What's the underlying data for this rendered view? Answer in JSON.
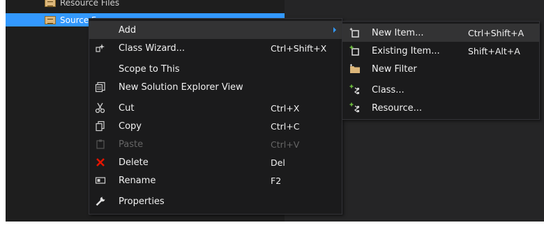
{
  "tree": {
    "partial_item": "Resource Files",
    "selected_item": "Source F"
  },
  "context_menu": {
    "items": [
      {
        "label": "Add",
        "shortcut": "",
        "icon": "none"
      },
      {
        "label": "Class Wizard...",
        "shortcut": "Ctrl+Shift+X",
        "icon": "class-wizard-icon"
      },
      {
        "label": "Scope to This",
        "shortcut": "",
        "icon": "none"
      },
      {
        "label": "New Solution Explorer View",
        "shortcut": "",
        "icon": "new-view-icon"
      },
      {
        "label": "Cut",
        "shortcut": "Ctrl+X",
        "icon": "scissors-icon"
      },
      {
        "label": "Copy",
        "shortcut": "Ctrl+C",
        "icon": "copy-icon"
      },
      {
        "label": "Paste",
        "shortcut": "Ctrl+V",
        "icon": "paste-icon",
        "disabled": true
      },
      {
        "label": "Delete",
        "shortcut": "Del",
        "icon": "delete-icon"
      },
      {
        "label": "Rename",
        "shortcut": "F2",
        "icon": "rename-icon"
      },
      {
        "label": "Properties",
        "shortcut": "",
        "icon": "wrench-icon"
      }
    ]
  },
  "submenu": {
    "items": [
      {
        "label": "New Item...",
        "shortcut": "Ctrl+Shift+A",
        "icon": "new-item-icon"
      },
      {
        "label": "Existing Item...",
        "shortcut": "Shift+Alt+A",
        "icon": "existing-item-icon"
      },
      {
        "label": "New Filter",
        "shortcut": "",
        "icon": "folder-icon"
      },
      {
        "label": "Class...",
        "shortcut": "",
        "icon": "add-class-icon"
      },
      {
        "label": "Resource...",
        "shortcut": "",
        "icon": "add-resource-icon"
      }
    ]
  },
  "colors": {
    "selection": "#3399ff",
    "menu_bg": "#1b1b1c",
    "delete_red": "#e51400"
  }
}
